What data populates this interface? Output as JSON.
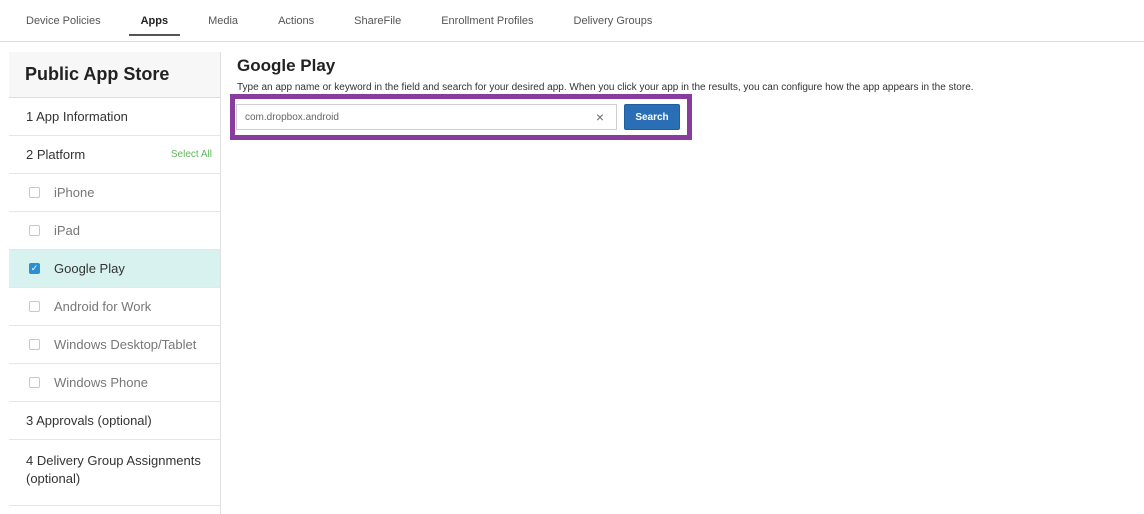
{
  "tabs": [
    "Device Policies",
    "Apps",
    "Media",
    "Actions",
    "ShareFile",
    "Enrollment Profiles",
    "Delivery Groups"
  ],
  "active_tab": "Apps",
  "sidebar": {
    "title": "Public App Store",
    "step1": "1  App Information",
    "step2": "2  Platform",
    "select_all": "Select All",
    "platforms": [
      {
        "label": "iPhone",
        "checked": false
      },
      {
        "label": "iPad",
        "checked": false
      },
      {
        "label": "Google Play",
        "checked": true
      },
      {
        "label": "Android for Work",
        "checked": false
      },
      {
        "label": "Windows Desktop/Tablet",
        "checked": false
      },
      {
        "label": "Windows Phone",
        "checked": false
      }
    ],
    "step3": "3  Approvals (optional)",
    "step4": "4  Delivery Group Assignments (optional)"
  },
  "main": {
    "title": "Google Play",
    "description": "Type an app name or keyword in the field and search for your desired app. When you click your app in the results, you can configure how the app appears in the store.",
    "search": {
      "value": "com.dropbox.android",
      "clear_symbol": "×",
      "button_label": "Search"
    }
  },
  "colors": {
    "accent": "#2a6fb6",
    "highlight": "#8a3c9e",
    "selected_row": "#d8f2ef",
    "select_all": "#5cb85c"
  }
}
